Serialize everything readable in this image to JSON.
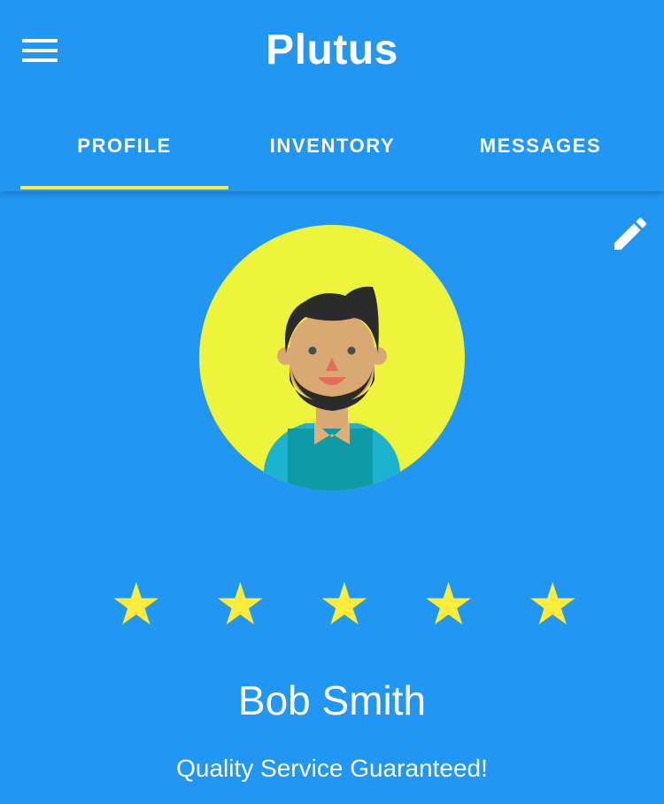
{
  "app": {
    "title": "Plutus",
    "menu_icon": "hamburger-menu-icon",
    "colors": {
      "primary": "#2196F3",
      "accent": "#FFEB3B",
      "avatar_bg": "#EEF43C"
    }
  },
  "tabs": [
    {
      "label": "PROFILE",
      "selected": true
    },
    {
      "label": "INVENTORY",
      "selected": false
    },
    {
      "label": "MESSAGES",
      "selected": false
    }
  ],
  "profile": {
    "edit_icon": "pencil-edit-icon",
    "avatar_icon": "user-avatar-illustration",
    "rating": 5,
    "rating_max": 5,
    "stars": [
      "★",
      "★",
      "★",
      "★",
      "★"
    ],
    "name": "Bob Smith",
    "tagline": "Quality Service Guaranteed!"
  }
}
